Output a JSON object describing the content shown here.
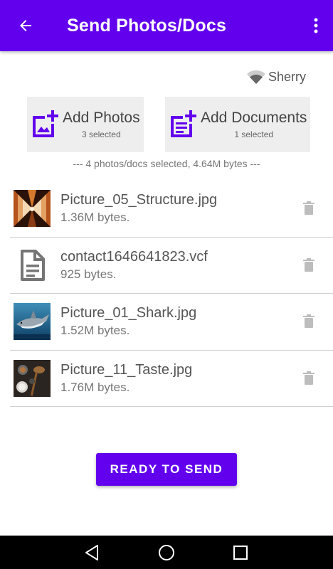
{
  "appbar": {
    "title": "Send Photos/Docs",
    "back_icon": "arrow-left-icon",
    "menu_icon": "more-vert-icon"
  },
  "network": {
    "icon": "wifi-icon",
    "name": "Sherry"
  },
  "add_photos": {
    "icon": "add-photo-icon",
    "label": "Add Photos",
    "count_label": "3 selected"
  },
  "add_documents": {
    "icon": "add-document-icon",
    "label": "Add Documents",
    "count_label": "1 selected"
  },
  "summary": "--- 4 photos/docs selected, 4.64M bytes ---",
  "files": [
    {
      "name": "Picture_05_Structure.jpg",
      "size": "1.36M bytes.",
      "thumbnail": "structure-photo"
    },
    {
      "name": "contact1646641823.vcf",
      "size": "925 bytes.",
      "thumbnail": "document-icon"
    },
    {
      "name": "Picture_01_Shark.jpg",
      "size": "1.52M bytes.",
      "thumbnail": "shark-photo"
    },
    {
      "name": "Picture_11_Taste.jpg",
      "size": "1.76M bytes.",
      "thumbnail": "taste-photo"
    }
  ],
  "send_button": "READY TO SEND",
  "colors": {
    "primary": "#6200ee",
    "card_bg": "#eeeeee",
    "nav_bar": "#000000"
  }
}
